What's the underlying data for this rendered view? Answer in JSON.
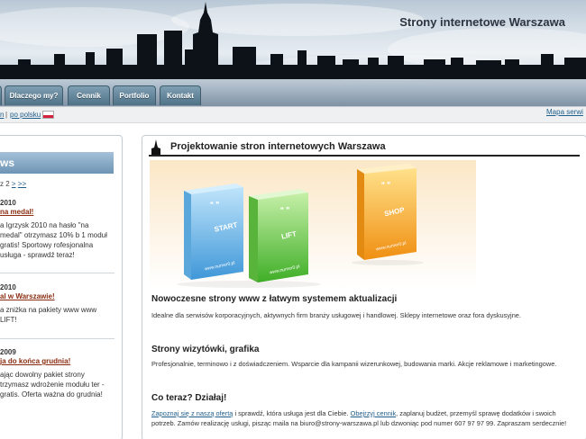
{
  "header": {
    "site_title": "Strony internetowe Warszawa"
  },
  "nav": {
    "tabs": [
      {
        "label": ""
      },
      {
        "label": "Dlaczego my?"
      },
      {
        "label": "Cennik"
      },
      {
        "label": "Portfolio"
      },
      {
        "label": "Kontakt"
      }
    ]
  },
  "langbar": {
    "current_lang_fragment": "n",
    "separator": "|",
    "polish_link": "po polsku",
    "sitemap_link": "Mapa serwi"
  },
  "sidebar": {
    "news_title": "ws",
    "pager": {
      "prefix": "z 2",
      "next": ">",
      "last": ">>"
    },
    "items": [
      {
        "date": "2010",
        "headline": "na medal!",
        "body": "a Igrzysk 2010 na hasło \"na medal\" otrzymasz 10% b 1 moduł gratis! Sportowy rofesjonalna usługa - sprawdź teraz!"
      },
      {
        "date": "2010",
        "headline": "al w Warszawie!",
        "body": "a zniżka na pakiety www www LIFT!"
      },
      {
        "date": "2009",
        "headline": "ja do końca grudnia!",
        "body": "ając dowolny pakiet strony trzymasz wdrożenie modułu ter - gratis. Oferta ważna do grudnia!"
      }
    ]
  },
  "main": {
    "page_title": "Projektowanie stron internetowych Warszawa",
    "banner": {
      "boxes": [
        {
          "label": "START",
          "brand": "www.numer0.pl",
          "color": "#4aa6e6"
        },
        {
          "label": "LIFT",
          "brand": "www.numer0.pl",
          "color": "#58c23c"
        },
        {
          "label": "SHOP",
          "brand": "www.numer0.pl",
          "color": "#f4a31c"
        }
      ]
    },
    "sections": [
      {
        "title": "Nowoczesne strony www z łatwym systemem aktualizacji",
        "text": "Idealne dla serwisów korporacyjnych, aktywnych firm branży usługowej i handlowej. Sklepy internetowe oraz fora dyskusyjne."
      },
      {
        "title": "Strony wizytówki, grafika",
        "text": "Profesjonalnie, terminowo i z doświadczeniem. Wsparcie dla kampanii wizerunkowej, budowania marki. Akcje reklamowe i marketingowe."
      },
      {
        "title": "Co teraz? Działaj!",
        "link1": "Zapoznaj się z naszą ofertą",
        "text1": " i sprawdź, która usługa jest dla Ciebie. ",
        "link2": "Obejrzyj cennik",
        "text2": ", zaplanuj budżet, przemyśl sprawę dodatków i swoich potrzeb. Zamów realizację usługi, pisząc maila na biuro@strony-warszawa.pl lub dzwoniąc pod numer 607 97 97 99. Zapraszam serdecznie!"
      }
    ]
  },
  "colors": {
    "nav_tab": "#5b7d91",
    "link": "#1f5e8a",
    "news_headline": "#8a2d10",
    "news_header": "#7a9fbf"
  }
}
